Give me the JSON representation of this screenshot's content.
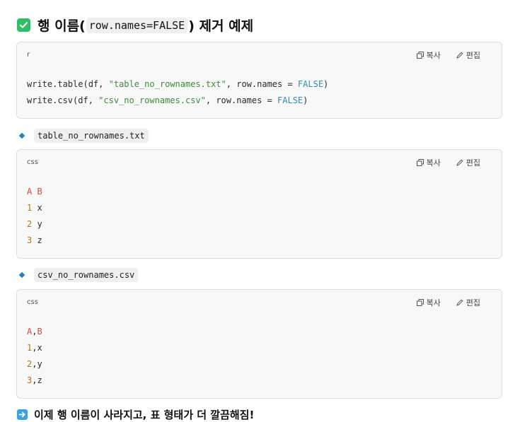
{
  "heading": {
    "prefix": "행 이름(",
    "code": "row.names=FALSE",
    "suffix": ") 제거 예제"
  },
  "blocks": [
    {
      "lang": "r",
      "copy_label": "복사",
      "edit_label": "편집",
      "lines": [
        [
          {
            "t": "write.table(df, ",
            "c": ""
          },
          {
            "t": "\"table_no_rownames.txt\"",
            "c": "str"
          },
          {
            "t": ", row.names = ",
            "c": ""
          },
          {
            "t": "FALSE",
            "c": "kw"
          },
          {
            "t": ")",
            "c": ""
          }
        ],
        [
          {
            "t": "write.csv(df, ",
            "c": ""
          },
          {
            "t": "\"csv_no_rownames.csv\"",
            "c": "str"
          },
          {
            "t": ", row.names = ",
            "c": ""
          },
          {
            "t": "FALSE",
            "c": "kw"
          },
          {
            "t": ")",
            "c": ""
          }
        ]
      ]
    },
    {
      "lang": "css",
      "copy_label": "복사",
      "edit_label": "편집",
      "lines": [
        [
          {
            "t": "A B",
            "c": "red"
          }
        ],
        [
          {
            "t": "1",
            "c": "num"
          },
          {
            "t": " x",
            "c": ""
          }
        ],
        [
          {
            "t": "2",
            "c": "num"
          },
          {
            "t": " y",
            "c": ""
          }
        ],
        [
          {
            "t": "3",
            "c": "num"
          },
          {
            "t": " z",
            "c": ""
          }
        ]
      ]
    },
    {
      "lang": "css",
      "copy_label": "복사",
      "edit_label": "편집",
      "lines": [
        [
          {
            "t": "A",
            "c": "red"
          },
          {
            "t": ",",
            "c": ""
          },
          {
            "t": "B",
            "c": "red"
          }
        ],
        [
          {
            "t": "1",
            "c": "num"
          },
          {
            "t": ",x",
            "c": ""
          }
        ],
        [
          {
            "t": "2",
            "c": "num"
          },
          {
            "t": ",y",
            "c": ""
          }
        ],
        [
          {
            "t": "3",
            "c": "num"
          },
          {
            "t": ",z",
            "c": ""
          }
        ]
      ]
    }
  ],
  "bullets": [
    {
      "code": "table_no_rownames.txt"
    },
    {
      "code": "csv_no_rownames.csv"
    }
  ],
  "footer": {
    "text": "이제 행 이름이 사라지고, 표 형태가 더 깔끔해짐!"
  },
  "colors": {
    "check": "#2dbf67",
    "string": "#3c8b3c",
    "keyword": "#2f8fb0",
    "header_red": "#d9493b",
    "number": "#b6731a",
    "bullet": "#1f7fc4",
    "arrow": "#3aa0e8"
  },
  "icons": {
    "heading": "check-box-icon",
    "copy": "copy-icon",
    "edit": "pencil-icon",
    "bullet": "diamond-icon",
    "footer": "right-arrow-icon"
  }
}
